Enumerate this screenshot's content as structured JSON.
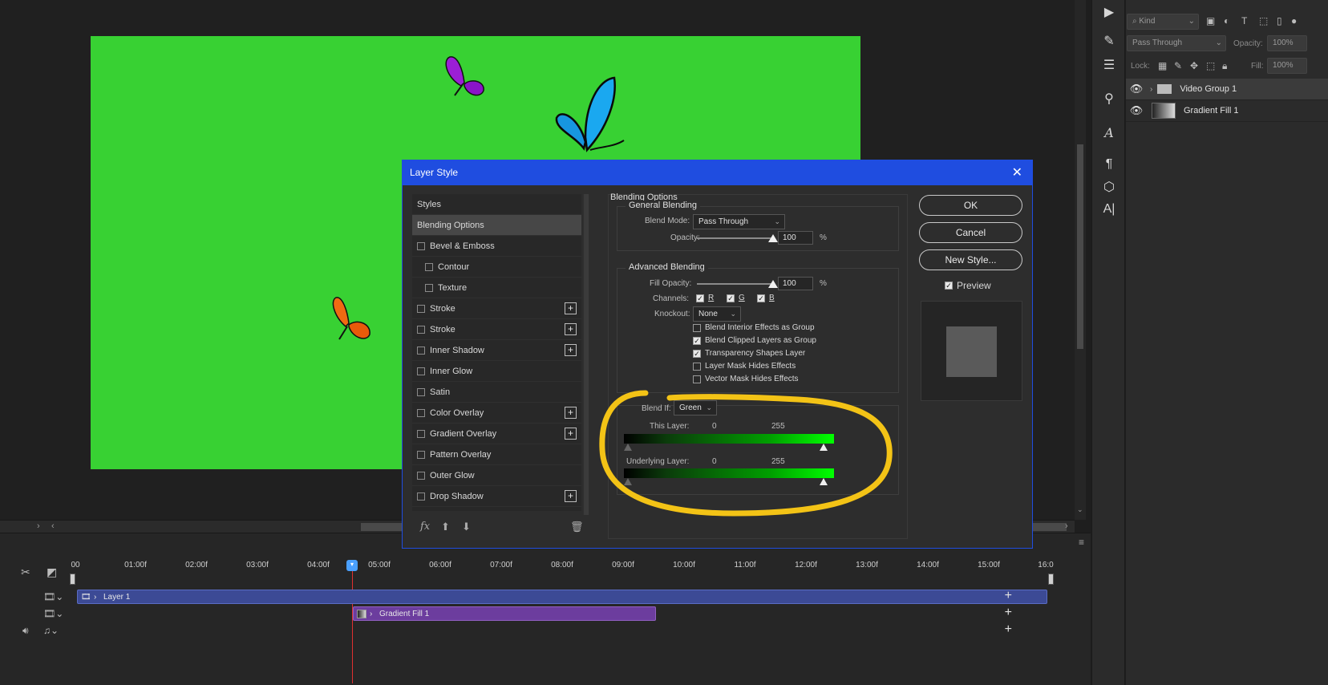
{
  "colors": {
    "canvas_green": "#38d133",
    "dialog_accent": "#1f4de0",
    "highlight": "#f3c316"
  },
  "layers_panel": {
    "filter_kind": "Kind",
    "blend_mode": "Pass Through",
    "opacity_label": "Opacity:",
    "opacity_value": "100%",
    "lock_label": "Lock:",
    "fill_label": "Fill:",
    "fill_value": "100%",
    "layers": [
      {
        "name": "Video Group 1",
        "icon": "film-icon"
      },
      {
        "name": "Gradient Fill 1",
        "icon": "gradient-thumb"
      }
    ]
  },
  "tools": [
    "play-icon",
    "brush-settings-icon",
    "adjustments-icon",
    "clone-source-icon",
    "character-style-icon",
    "paragraph-icon",
    "3d-icon",
    "glyphs-icon"
  ],
  "timeline": {
    "ticks": [
      "00",
      "01:00f",
      "02:00f",
      "03:00f",
      "04:00f",
      "05:00f",
      "06:00f",
      "07:00f",
      "08:00f",
      "09:00f",
      "10:00f",
      "11:00f",
      "12:00f",
      "13:00f",
      "14:00f",
      "15:00f",
      "16:0"
    ],
    "tracks": [
      {
        "name": "Layer 1"
      },
      {
        "name": "Gradient Fill 1"
      }
    ]
  },
  "dialog": {
    "title": "Layer Style",
    "styles": [
      {
        "label": "Styles",
        "checkbox": false,
        "plus": false,
        "active": false,
        "indent": false
      },
      {
        "label": "Blending Options",
        "checkbox": false,
        "plus": false,
        "active": true,
        "indent": false
      },
      {
        "label": "Bevel & Emboss",
        "checkbox": true,
        "plus": false,
        "active": false,
        "indent": false
      },
      {
        "label": "Contour",
        "checkbox": true,
        "plus": false,
        "active": false,
        "indent": true
      },
      {
        "label": "Texture",
        "checkbox": true,
        "plus": false,
        "active": false,
        "indent": true
      },
      {
        "label": "Stroke",
        "checkbox": true,
        "plus": true,
        "active": false,
        "indent": false
      },
      {
        "label": "Stroke",
        "checkbox": true,
        "plus": true,
        "active": false,
        "indent": false
      },
      {
        "label": "Inner Shadow",
        "checkbox": true,
        "plus": true,
        "active": false,
        "indent": false
      },
      {
        "label": "Inner Glow",
        "checkbox": true,
        "plus": false,
        "active": false,
        "indent": false
      },
      {
        "label": "Satin",
        "checkbox": true,
        "plus": false,
        "active": false,
        "indent": false
      },
      {
        "label": "Color Overlay",
        "checkbox": true,
        "plus": true,
        "active": false,
        "indent": false
      },
      {
        "label": "Gradient Overlay",
        "checkbox": true,
        "plus": true,
        "active": false,
        "indent": false
      },
      {
        "label": "Pattern Overlay",
        "checkbox": true,
        "plus": false,
        "active": false,
        "indent": false
      },
      {
        "label": "Outer Glow",
        "checkbox": true,
        "plus": false,
        "active": false,
        "indent": false
      },
      {
        "label": "Drop Shadow",
        "checkbox": true,
        "plus": true,
        "active": false,
        "indent": false
      }
    ],
    "footer_fx": "fx",
    "blending_options_title": "Blending Options",
    "general_blending_title": "General Blending",
    "blend_mode_label": "Blend Mode:",
    "blend_mode_value": "Pass Through",
    "opacity_label": "Opacity:",
    "opacity_value": "100",
    "percent": "%",
    "advanced_blending_title": "Advanced Blending",
    "fill_opacity_label": "Fill Opacity:",
    "fill_opacity_value": "100",
    "channels_label": "Channels:",
    "channel_r": "R",
    "channel_g": "G",
    "channel_b": "B",
    "knockout_label": "Knockout:",
    "knockout_value": "None",
    "options": [
      {
        "label": "Blend Interior Effects as Group",
        "checked": false
      },
      {
        "label": "Blend Clipped Layers as Group",
        "checked": true
      },
      {
        "label": "Transparency Shapes Layer",
        "checked": true
      },
      {
        "label": "Layer Mask Hides Effects",
        "checked": false
      },
      {
        "label": "Vector Mask Hides Effects",
        "checked": false
      }
    ],
    "blend_if_label": "Blend If:",
    "blend_if_value": "Green",
    "this_layer_label": "This Layer:",
    "this_layer_min": "0",
    "this_layer_max": "255",
    "underlying_layer_label": "Underlying Layer:",
    "underlying_min": "0",
    "underlying_max": "255",
    "ok_label": "OK",
    "cancel_label": "Cancel",
    "new_style_label": "New Style...",
    "preview_label": "Preview"
  }
}
